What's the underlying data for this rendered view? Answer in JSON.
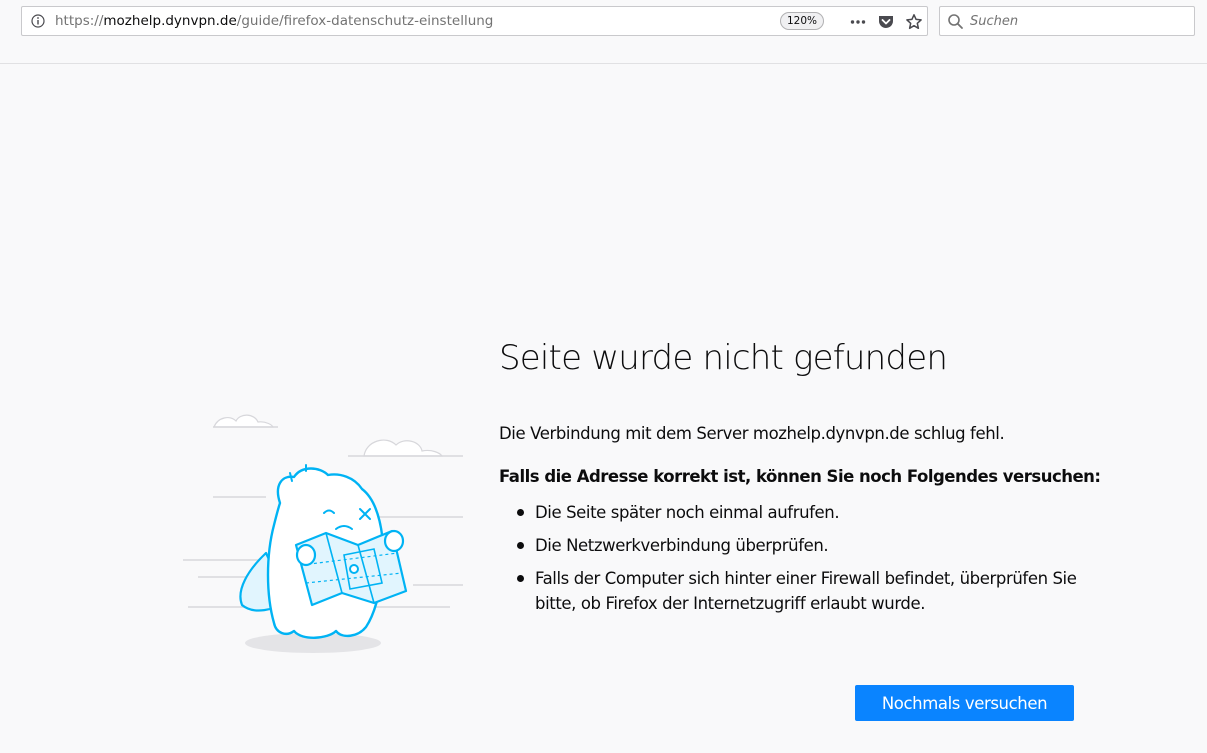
{
  "toolbar": {
    "url_prefix": "https://",
    "url_host": "mozhelp.dynvpn.de",
    "url_path": "/guide/firefox-datenschutz-einstellung",
    "zoom": "120%",
    "icons": [
      "info-icon",
      "page-actions-icon",
      "pocket-icon",
      "bookmark-star-icon"
    ],
    "search_placeholder": "Suchen",
    "search_icon": "search-icon"
  },
  "error": {
    "title": "Seite wurde nicht gefunden",
    "description": "Die Verbindung mit dem Server mozhelp.dynvpn.de schlug fehl.",
    "suggestion_heading": "Falls die Adresse korrekt ist, können Sie noch Folgendes versuchen:",
    "suggestions": [
      "Die Seite später noch einmal aufrufen.",
      "Die Netzwerkverbindung überprüfen.",
      "Falls der Computer sich hinter einer Firewall befindet, überprüfen Sie bitte, ob Firefox der Internetzugriff erlaubt wurde."
    ],
    "retry_label": "Nochmals versuchen"
  },
  "colors": {
    "accent": "#0a84ff",
    "background": "#f9f9fa",
    "illustration_stroke": "#00b3f4",
    "illustration_fill": "#e1f5fe"
  }
}
